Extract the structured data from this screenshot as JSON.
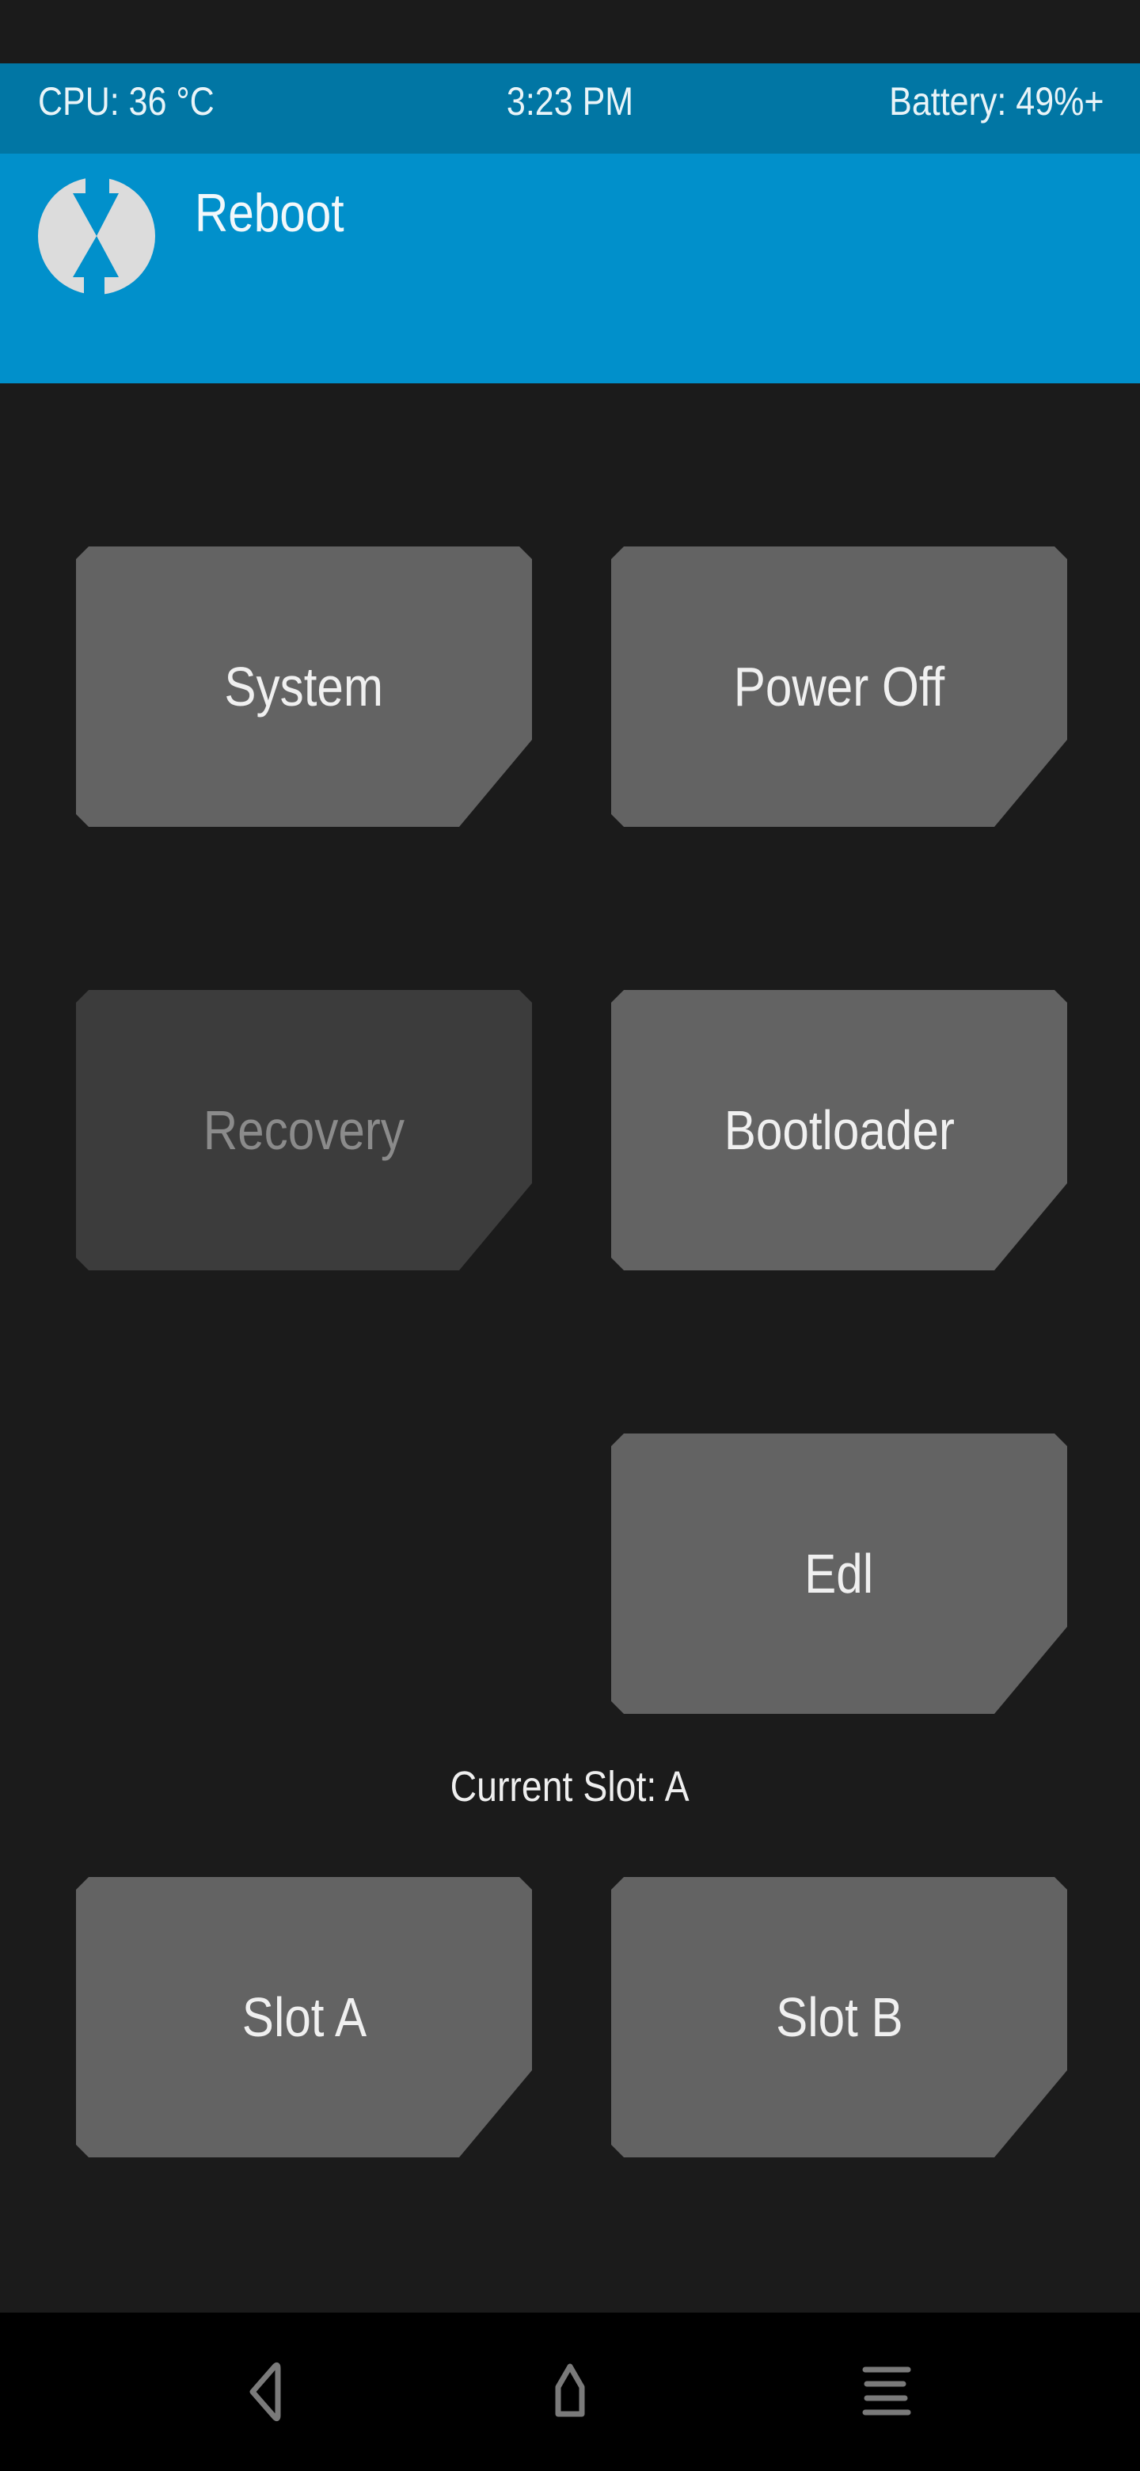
{
  "status_bar": {
    "cpu": "CPU: 36 °C",
    "time": "3:23 PM",
    "battery": "Battery: 49%+"
  },
  "header": {
    "logo_icon": "twrp-logo-icon",
    "title": "Reboot"
  },
  "buttons": {
    "system": {
      "label": "System",
      "enabled": true
    },
    "power_off": {
      "label": "Power Off",
      "enabled": true
    },
    "recovery": {
      "label": "Recovery",
      "enabled": false
    },
    "bootloader": {
      "label": "Bootloader",
      "enabled": true
    },
    "edl": {
      "label": "Edl",
      "enabled": true
    },
    "slot_a": {
      "label": "Slot A",
      "enabled": true
    },
    "slot_b": {
      "label": "Slot B",
      "enabled": true
    }
  },
  "current_slot_label": "Current Slot: A",
  "nav_bar": {
    "back_icon": "back-triangle-icon",
    "home_icon": "home-icon",
    "menu_icon": "menu-lines-icon"
  },
  "colors": {
    "status_bar_bg": "#0176a4",
    "title_bar_bg": "#0190cb",
    "background": "#1b1b1b",
    "button_bg": "#636363",
    "button_disabled_bg": "#3c3c3c",
    "nav_icon": "#7a7a7a"
  }
}
